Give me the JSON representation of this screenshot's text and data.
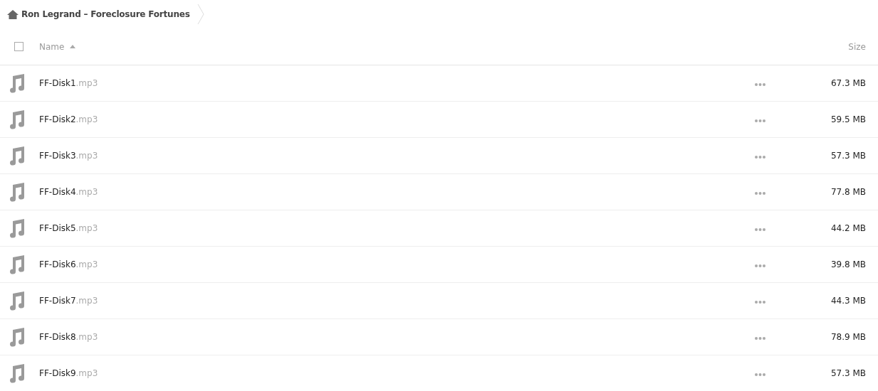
{
  "breadcrumb": {
    "title": "Ron Legrand – Foreclosure Fortunes"
  },
  "header": {
    "select_all": {
      "checked": false
    },
    "name_column": "Name",
    "size_column": "Size"
  },
  "files": [
    {
      "name": "FF-Disk1",
      "extension": ".mp3",
      "size": "67.3 MB"
    },
    {
      "name": "FF-Disk2",
      "extension": ".mp3",
      "size": "59.5 MB"
    },
    {
      "name": "FF-Disk3",
      "extension": ".mp3",
      "size": "57.3 MB"
    },
    {
      "name": "FF-Disk4",
      "extension": ".mp3",
      "size": "77.8 MB"
    },
    {
      "name": "FF-Disk5",
      "extension": ".mp3",
      "size": "44.2 MB"
    },
    {
      "name": "FF-Disk6",
      "extension": ".mp3",
      "size": "39.8 MB"
    },
    {
      "name": "FF-Disk7",
      "extension": ".mp3",
      "size": "44.3 MB"
    },
    {
      "name": "FF-Disk8",
      "extension": ".mp3",
      "size": "78.9 MB"
    },
    {
      "name": "FF-Disk9",
      "extension": ".mp3",
      "size": "57.3 MB"
    }
  ]
}
